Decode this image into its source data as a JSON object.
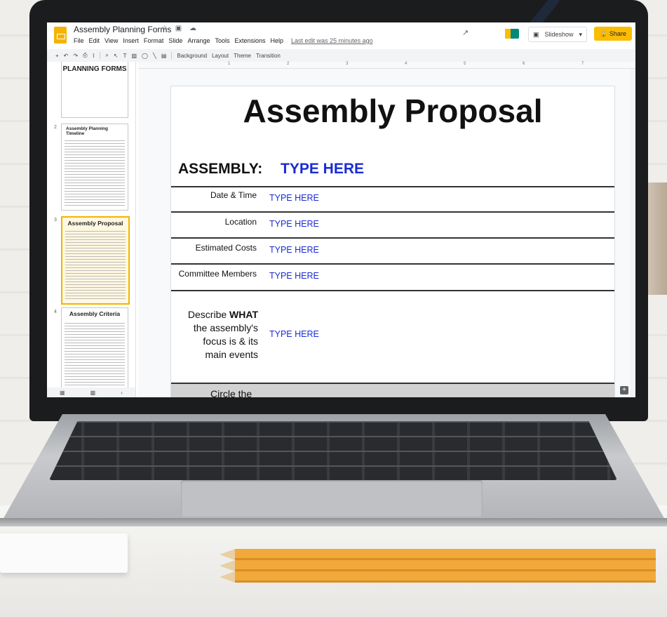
{
  "app": {
    "title": "Assembly Planning Forms",
    "title_icons": "☆ ▣ ☁",
    "menu": [
      "File",
      "Edit",
      "View",
      "Insert",
      "Format",
      "Slide",
      "Arrange",
      "Tools",
      "Extensions",
      "Help"
    ],
    "last_edit": "Last edit was 25 minutes ago",
    "slideshow_label": "Slideshow",
    "share_label": "Share",
    "toolbar": {
      "background": "Background",
      "layout": "Layout",
      "theme": "Theme",
      "transition": "Transition"
    },
    "ruler": [
      "1",
      "2",
      "3",
      "4",
      "5",
      "6",
      "7"
    ],
    "colors": {
      "brand": "#f4b400",
      "type_here": "#1a2bd6",
      "share_bg": "#fbbc04"
    }
  },
  "filmstrip": {
    "slides": [
      {
        "num": "",
        "title": "PLANNING FORMS"
      },
      {
        "num": "2",
        "title": "Assembly Planning Timeline"
      },
      {
        "num": "3",
        "title": "Assembly Proposal",
        "selected": true
      },
      {
        "num": "4",
        "title": "Assembly Criteria"
      }
    ]
  },
  "slide": {
    "title": "Assembly Proposal",
    "assembly_label": "ASSEMBLY:",
    "assembly_value": "TYPE HERE",
    "rows": [
      {
        "label": "Date & Time",
        "value": "TYPE HERE"
      },
      {
        "label": "Location",
        "value": "TYPE HERE"
      },
      {
        "label": "Estimated Costs",
        "value": "TYPE HERE"
      },
      {
        "label": "Committee Members",
        "value": "TYPE HERE"
      }
    ],
    "describe": {
      "line1_pre": "Describe ",
      "line1_bold": "WHAT",
      "line2": "the assembly's",
      "line3": "focus is & its",
      "line4": "main events",
      "value": "TYPE HERE"
    },
    "circle_label": "Circle the"
  }
}
